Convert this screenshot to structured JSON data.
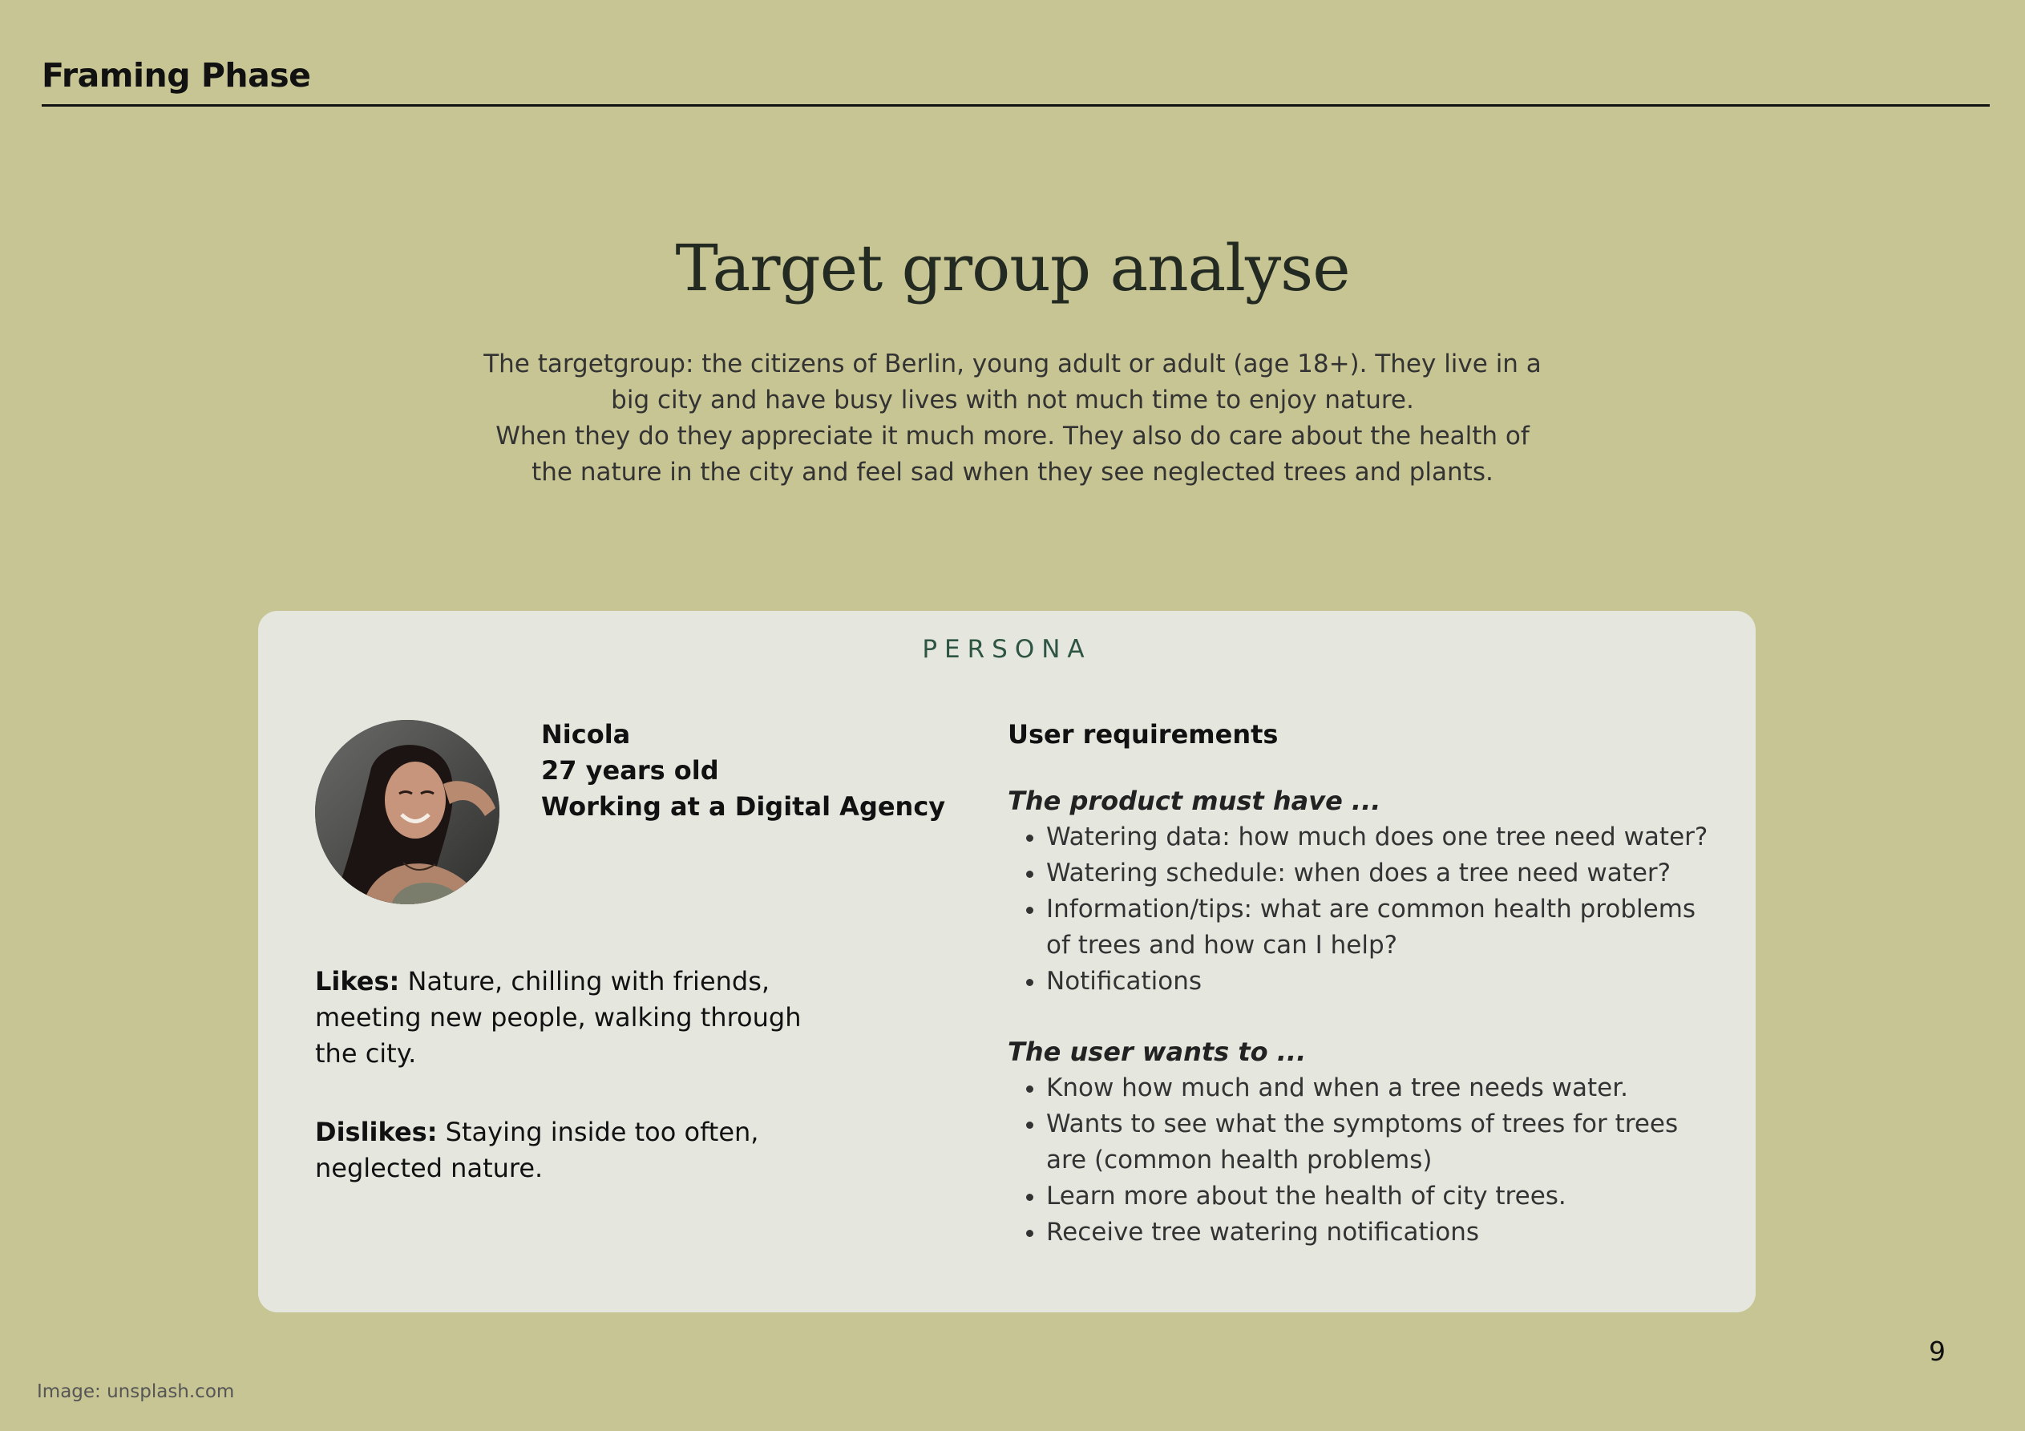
{
  "header": {
    "title": "Framing Phase"
  },
  "page": {
    "title": "Target group analyse",
    "intro_lines": [
      "The targetgroup: the citizens of Berlin, young adult or adult (age 18+). They live in a big city and have busy lives with not much time to enjoy nature.",
      "When they do they appreciate it much more. They also do care about the health of the nature in the city and feel sad when they see neglected trees and plants."
    ],
    "page_number": "9",
    "image_credit": "Image: unsplash.com"
  },
  "persona": {
    "label": "PERSONA",
    "name": "Nicola",
    "age": "27 years old",
    "job": "Working at a Digital Agency",
    "likes_label": "Likes:",
    "likes_text": " Nature, chilling with friends, meeting new people, walking through the city.",
    "dislikes_label": "Dislikes:",
    "dislikes_text": " Staying inside too often, neglected nature."
  },
  "requirements": {
    "title": "User requirements",
    "must_have_heading": "The product must have ...",
    "must_have_items": [
      "Watering data: how much does one tree need water?",
      "Watering schedule: when does a tree need water?",
      "Information/tips: what are common health problems of trees and how can I help?",
      "Notifications"
    ],
    "user_wants_heading": "The user wants to ...",
    "user_wants_items": [
      "Know how much and when a tree needs water.",
      "Wants to see what the symptoms of trees for trees are (common health problems)",
      "Learn more about the health of city trees.",
      "Receive tree watering notifications"
    ]
  },
  "colors": {
    "background": "#c7c593",
    "card": "#e5e7df",
    "persona_label": "#2e5443"
  }
}
